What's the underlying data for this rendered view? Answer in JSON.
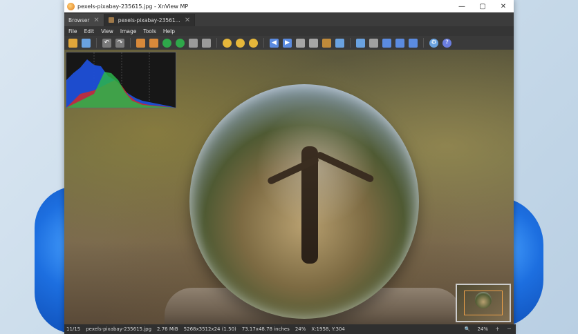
{
  "window": {
    "title": "pexels-pixabay-235615.jpg - XnView MP"
  },
  "tabs": [
    {
      "label": "Browser"
    },
    {
      "label": "pexels-pixabay-23561..."
    }
  ],
  "menu": [
    "File",
    "Edit",
    "View",
    "Image",
    "Tools",
    "Help"
  ],
  "toolbar": {
    "icons": [
      "browser-icon",
      "save-icon",
      "undo-icon",
      "redo-icon",
      "fullscreen-icon",
      "slideshow-icon",
      "refresh-icon",
      "next-icon",
      "adjust-icon",
      "chart-icon",
      "zoom-in-icon",
      "zoom-fit-icon",
      "zoom-out-icon",
      "prev-icon",
      "next-icon",
      "rotate-left-icon",
      "rotate-right-icon",
      "crop-icon",
      "compare-icon",
      "resize-icon",
      "tools-icon",
      "print-icon",
      "scanner-icon",
      "export-icon",
      "settings-icon",
      "help-icon"
    ]
  },
  "status": {
    "index": "11/15",
    "filename": "pexels-pixabay-235615.jpg",
    "size": "2.76 MiB",
    "dimensions": "5268x3512x24 (1.50)",
    "inches": "73.17x48.78 inches",
    "zoom": "24%",
    "coords": "X:1958, Y:304",
    "zoom_right": "24%"
  },
  "colors": {
    "window_bg": "#2b2b2b",
    "accent": "#4a8fe0"
  }
}
